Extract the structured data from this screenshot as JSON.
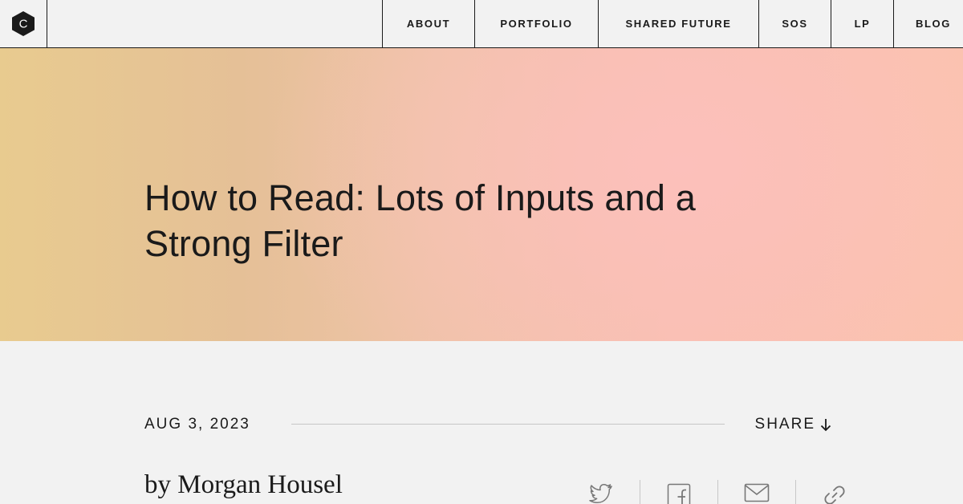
{
  "logo": {
    "icon": "hexagon-c-logo-icon",
    "letter": "C"
  },
  "nav": {
    "items": [
      {
        "label": "ABOUT"
      },
      {
        "label": "PORTFOLIO"
      },
      {
        "label": "SHARED FUTURE"
      },
      {
        "label": "SOS"
      },
      {
        "label": "LP"
      },
      {
        "label": "BLOG"
      }
    ]
  },
  "hero": {
    "title": "How to Read: Lots of Inputs and a Strong Filter",
    "colors": {
      "left": "#e8cb8f",
      "center": "#fcc0bb",
      "right": "#fbc3ad"
    }
  },
  "article": {
    "date": "AUG 3, 2023",
    "share_label": "SHARE",
    "share_icon": "arrow-down-icon",
    "author": "by Morgan Housel",
    "share_links": [
      {
        "icon": "twitter-icon"
      },
      {
        "icon": "facebook-icon"
      },
      {
        "icon": "email-icon"
      },
      {
        "icon": "link-icon"
      }
    ]
  }
}
